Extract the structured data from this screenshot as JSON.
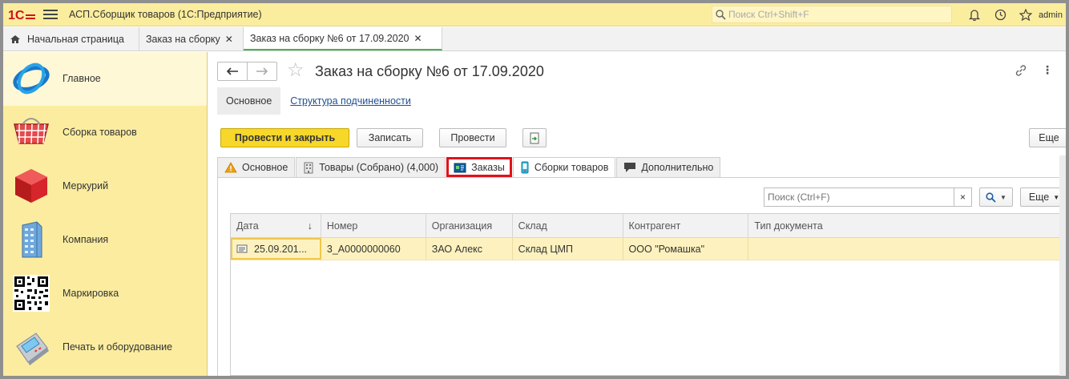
{
  "app": {
    "title": "АСП.Сборщик товаров  (1С:Предприятие)",
    "search_placeholder": "Поиск Ctrl+Shift+F",
    "user": "admin",
    "logo_text": "1С"
  },
  "window_tabs": [
    {
      "label": "Начальная страница",
      "closable": false
    },
    {
      "label": "Заказ на сборку",
      "closable": true
    },
    {
      "label": "Заказ на сборку №6 от 17.09.2020",
      "closable": true
    }
  ],
  "sidebar": {
    "items": [
      {
        "label": "Главное"
      },
      {
        "label": "Сборка товаров"
      },
      {
        "label": "Меркурий"
      },
      {
        "label": "Компания"
      },
      {
        "label": "Маркировка"
      },
      {
        "label": "Печать и оборудование"
      }
    ]
  },
  "document": {
    "title": "Заказ на сборку №6 от 17.09.2020",
    "subnav_main": "Основное",
    "subnav_link": "Структура подчиненности"
  },
  "toolbar": {
    "post_close": "Провести и закрыть",
    "save": "Записать",
    "post": "Провести",
    "more": "Еще"
  },
  "tabs": [
    {
      "label": "Основное"
    },
    {
      "label": "Товары (Собрано) (4,000)"
    },
    {
      "label": "Заказы"
    },
    {
      "label": "Сборки товаров"
    },
    {
      "label": "Дополнительно"
    }
  ],
  "list": {
    "search_placeholder": "Поиск (Ctrl+F)",
    "clear": "×",
    "more": "Еще",
    "columns": [
      "Дата",
      "Номер",
      "Организация",
      "Склад",
      "Контрагент",
      "Тип документа"
    ],
    "rows": [
      [
        "25.09.201...",
        "3_А0000000060",
        "ЗАО Алекс",
        "Склад ЦМП",
        "ООО \"Ромашка\"",
        ""
      ]
    ]
  },
  "colors": {
    "topbar": "#fbed9e",
    "sidebar": "#fbeca0",
    "primary_button": "#f7d72a",
    "highlight": "#e0121b",
    "row_selected": "#fdf2bf"
  }
}
